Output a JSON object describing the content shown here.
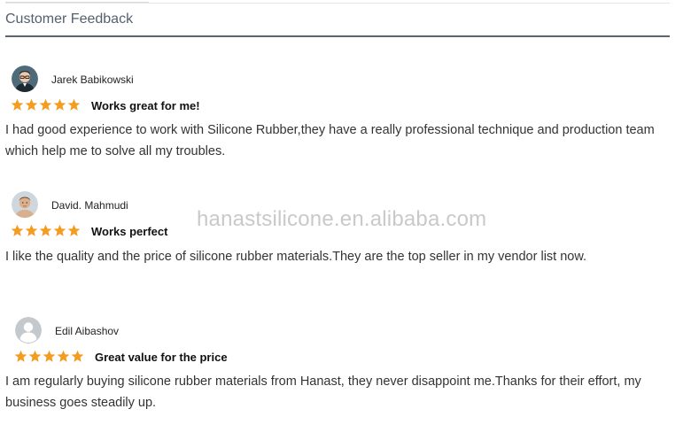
{
  "section": {
    "title": "Customer Feedback"
  },
  "watermark": "hanastsilicone.en.alibaba.com",
  "reviews": [
    {
      "name": "Jarek Babikowski",
      "rating": 5,
      "title": "Works great for me!",
      "body": "I had good experience to work with  Silicone Rubber,they have a really professional technique and production team which help me to solve all my troubles.",
      "avatar_icon": "man-with-glasses-avatar-icon"
    },
    {
      "name": "David. Mahmudi",
      "rating": 5,
      "title": "Works perfect",
      "body": "I like the quality and the price of silicone rubber materials.They are the top seller in my vendor list now.",
      "avatar_icon": "man-photo-avatar-icon"
    },
    {
      "name": "Edil Aibashov",
      "rating": 5,
      "title": "Great value for the price",
      "body": "I am regularly buying silicone rubber materials from Hanast, they never disappoint me.Thanks for their effort, my business goes steadily up.",
      "avatar_icon": "default-user-avatar-icon"
    }
  ],
  "colors": {
    "star": "#f39c1f",
    "rule": "#5c6470",
    "watermark": "#c9c9c9"
  }
}
